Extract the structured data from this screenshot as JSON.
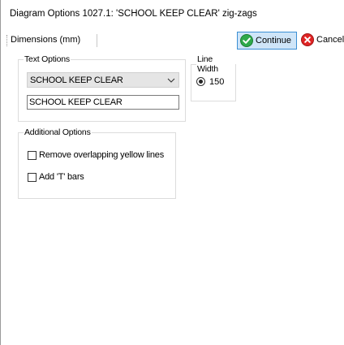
{
  "window": {
    "title": "Diagram Options 1027.1: 'SCHOOL KEEP CLEAR' zig-zags"
  },
  "toolbar": {
    "dimensions_label": "Dimensions (mm)",
    "continue_label": "Continue",
    "cancel_label": "Cancel"
  },
  "text_options": {
    "title": "Text Options",
    "selected_text": "SCHOOL KEEP CLEAR",
    "text_value": "SCHOOL KEEP CLEAR"
  },
  "line_width": {
    "title": "Line Width",
    "option_label": "150",
    "selected": true
  },
  "additional_options": {
    "title": "Additional Options",
    "items": [
      {
        "label": "Remove overlapping yellow lines",
        "checked": false
      },
      {
        "label": "Add 'T' bars",
        "checked": false
      }
    ]
  },
  "colors": {
    "continue_green": "#2ea94a",
    "cancel_red": "#e02424",
    "button_hover_bg": "#cfe5f8",
    "button_hover_border": "#3c8fd4"
  },
  "icons": {
    "continue": "check-circle-icon",
    "cancel": "x-circle-icon",
    "dropdown": "chevron-down-icon"
  }
}
